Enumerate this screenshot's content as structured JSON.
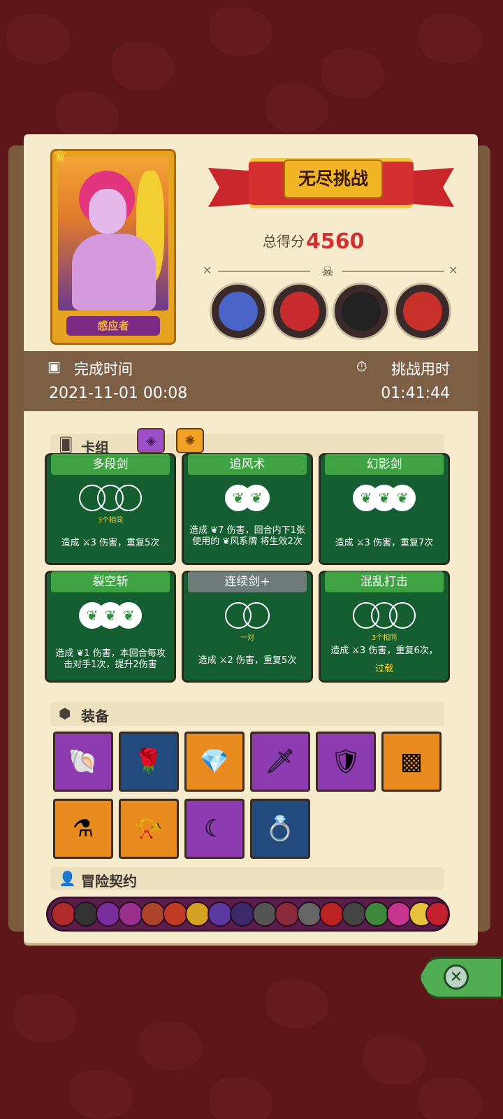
{
  "title": "无尽挑战",
  "score": {
    "label": "总得分",
    "value": "4560"
  },
  "character": {
    "name": "感应者"
  },
  "time": {
    "finish_label": "完成时间",
    "finish_value": "2021-11-01 00:08",
    "duration_label": "挑战用时",
    "duration_value": "01:41:44"
  },
  "deck": {
    "header": "卡组",
    "cards": [
      {
        "name": "多段剑",
        "sub": "3个相同",
        "desc": "造成 ⚔3 伤害，重复5次"
      },
      {
        "name": "追风术",
        "sub": "",
        "desc": "造成 ❦7 伤害，回合内下1张使用的 ❦风系牌 将生效2次"
      },
      {
        "name": "幻影剑",
        "sub": "",
        "desc": "造成 ⚔3 伤害，重复7次"
      },
      {
        "name": "裂空斩",
        "sub": "",
        "desc": "造成 ❦1 伤害，本回合每攻击对手1次，提升2伤害"
      },
      {
        "name": "连续剑+",
        "sub": "一对",
        "desc": "造成 ⚔2 伤害，重复5次"
      },
      {
        "name": "混乱打击",
        "sub": "3个相同",
        "desc": "造成 ⚔3 伤害，重复6次，",
        "overload": "过载"
      }
    ]
  },
  "equipment": {
    "header": "装备",
    "items": [
      {
        "icon": "pink-shell-icon",
        "bg": "#8c3bb0"
      },
      {
        "icon": "red-rose-icon",
        "bg": "#234a7c"
      },
      {
        "icon": "blue-stone-icon",
        "bg": "#e98b1e"
      },
      {
        "icon": "dagger-icon",
        "bg": "#8c3bb0"
      },
      {
        "icon": "armor-icon",
        "bg": "#8c3bb0"
      },
      {
        "icon": "green-tablet-icon",
        "bg": "#e98b1e"
      },
      {
        "icon": "potion-icon",
        "bg": "#e98b1e"
      },
      {
        "icon": "horn-icon",
        "bg": "#e98b1e"
      },
      {
        "icon": "crescent-blade-icon",
        "bg": "#8c3bb0"
      },
      {
        "icon": "gold-ring-icon",
        "bg": "#234a7c"
      }
    ]
  },
  "contracts": {
    "header": "冒险契约"
  }
}
